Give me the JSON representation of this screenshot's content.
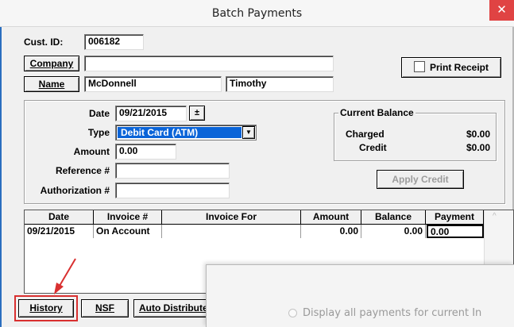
{
  "window": {
    "title": "Batch Payments",
    "close_glyph": "✕"
  },
  "customer": {
    "cust_id_label": "Cust. ID:",
    "cust_id_value": "006182",
    "company_button": "Company",
    "company_value": "",
    "name_button": "Name",
    "last_name": "McDonnell",
    "first_name": "Timothy"
  },
  "print_receipt": {
    "label": "Print Receipt",
    "checked": false
  },
  "payment": {
    "date_label": "Date",
    "date_value": "09/21/2015",
    "type_label": "Type",
    "type_value": "Debit Card (ATM)",
    "amount_label": "Amount",
    "amount_value": "0.00",
    "reference_label": "Reference #",
    "reference_value": "",
    "authorization_label": "Authorization #",
    "authorization_value": ""
  },
  "balance": {
    "title": "Current Balance",
    "charged_label": "Charged",
    "charged_value": "$0.00",
    "credit_label": "Credit",
    "credit_value": "$0.00",
    "apply_credit_button": "Apply Credit"
  },
  "invoice_table": {
    "headers": [
      "Date",
      "Invoice #",
      "Invoice For",
      "Amount",
      "Balance",
      "Payment"
    ],
    "rows": [
      {
        "date": "09/21/2015",
        "invoice": "On Account",
        "invoice_for": "",
        "amount": "0.00",
        "balance": "0.00",
        "payment": "0.00"
      }
    ]
  },
  "bottom_buttons": {
    "history": "History",
    "nsf": "NSF",
    "auto_distribute": "Auto Distribute"
  },
  "overlay_dialog": {
    "radio_label": "Display all payments for current In"
  },
  "colors": {
    "highlight": "#0a64d8",
    "close": "#e04343",
    "annotation": "#d93030"
  }
}
